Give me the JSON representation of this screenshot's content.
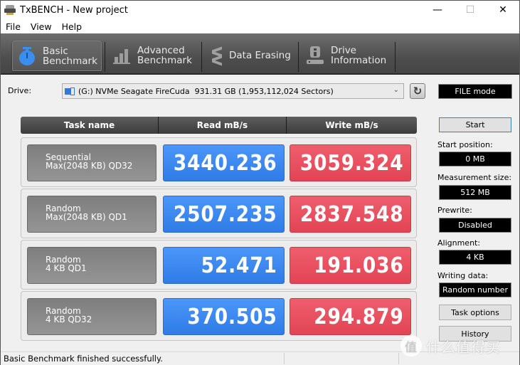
{
  "window": {
    "title": "TxBENCH - New project",
    "controls": {
      "minimize": "—",
      "maximize": "☐",
      "close": "✕"
    }
  },
  "menu": [
    "File",
    "View",
    "Help"
  ],
  "tabs": [
    {
      "line1": "Basic",
      "line2": "Benchmark",
      "icon": "stopwatch-icon",
      "active": true
    },
    {
      "line1": "Advanced",
      "line2": "Benchmark",
      "icon": "bar-chart-icon",
      "active": false
    },
    {
      "line1": "Data Erasing",
      "line2": "",
      "icon": "erase-icon",
      "active": false
    },
    {
      "line1": "Drive",
      "line2": "Information",
      "icon": "drive-info-icon",
      "active": false
    }
  ],
  "drive": {
    "label": "Drive:",
    "selected": "(G:) NVMe Seagate FireCuda  931.31 GB (1,953,112,024 Sectors)",
    "mode": "FILE mode"
  },
  "results": {
    "headers": {
      "task": "Task name",
      "read": "Read mB/s",
      "write": "Write mB/s"
    },
    "rows": [
      {
        "line1": "Sequential",
        "line2": "Max(2048 KB) QD32",
        "read": "3440.236",
        "write": "3059.324"
      },
      {
        "line1": "Random",
        "line2": "Max(2048 KB) QD1",
        "read": "2507.235",
        "write": "2837.548"
      },
      {
        "line1": "Random",
        "line2": "4 KB QD1",
        "read": "52.471",
        "write": "191.036"
      },
      {
        "line1": "Random",
        "line2": "4 KB QD32",
        "read": "370.505",
        "write": "294.879"
      }
    ],
    "colors": {
      "read": "#3a8af2",
      "write": "#e84d5c"
    }
  },
  "options": {
    "start_button": "Start",
    "start_position": {
      "label": "Start position:",
      "value": "0 MB"
    },
    "measurement_size": {
      "label": "Measurement size:",
      "value": "512 MB"
    },
    "prewrite": {
      "label": "Prewrite:",
      "value": "Disabled"
    },
    "alignment": {
      "label": "Alignment:",
      "value": "4 KB"
    },
    "writing_data": {
      "label": "Writing data:",
      "value": "Random number"
    },
    "task_options_button": "Task options",
    "history_button": "History"
  },
  "status": {
    "message": "Basic Benchmark finished successfully."
  },
  "watermark": {
    "glyph": "值",
    "text": "什么值得买"
  }
}
